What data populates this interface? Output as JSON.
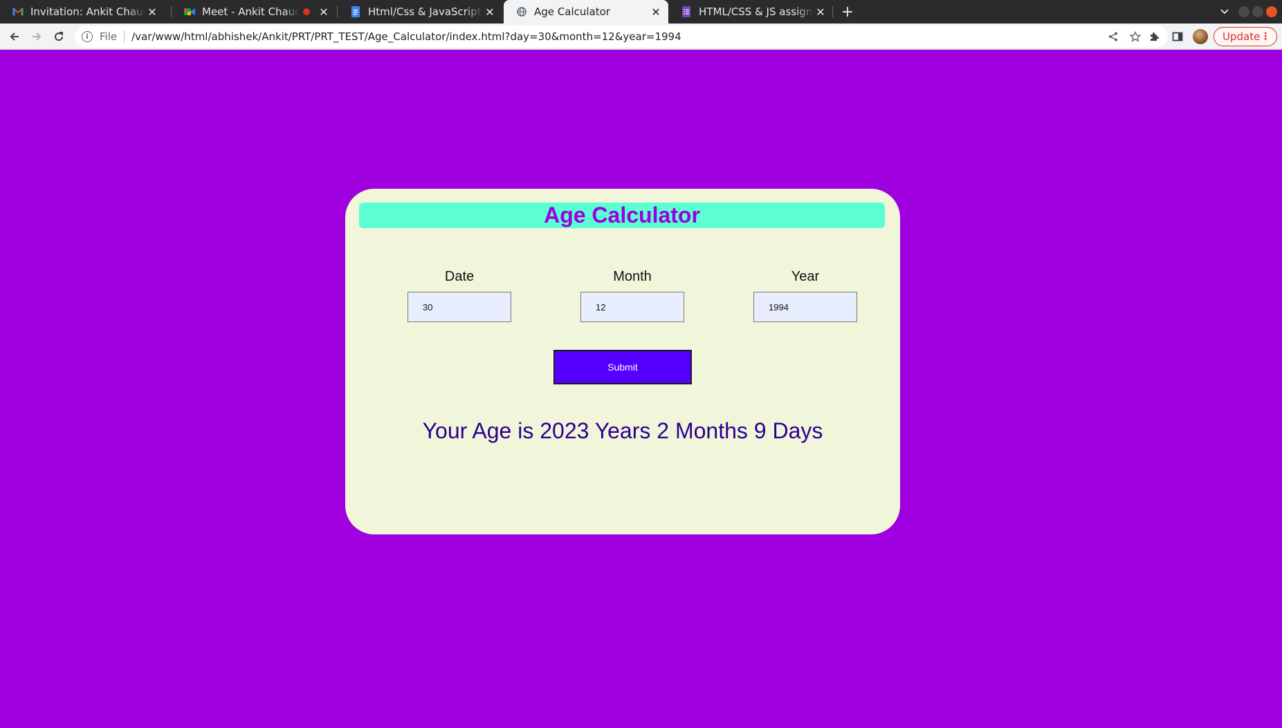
{
  "browser": {
    "tabs": [
      {
        "title": "Invitation: Ankit Chaudhary",
        "icon": "gmail-icon",
        "active": false
      },
      {
        "title": "Meet - Ankit Chaudhary",
        "icon": "meet-icon",
        "active": false,
        "recording": true
      },
      {
        "title": "Html/Css & JavaScript - Assignment",
        "icon": "docs-icon",
        "active": false
      },
      {
        "title": "Age Calculator",
        "icon": "globe-icon",
        "active": true
      },
      {
        "title": "HTML/CSS & JS assignment",
        "icon": "forms-icon",
        "active": false
      }
    ],
    "new_tab_label": "+",
    "address": {
      "scheme_label": "File",
      "url": "/var/www/html/abhishek/Ankit/PRT/PRT_TEST/Age_Calculator/index.html?day=30&month=12&year=1994"
    },
    "update_label": "Update"
  },
  "app": {
    "title": "Age Calculator",
    "fields": [
      {
        "label": "Date",
        "value": "30"
      },
      {
        "label": "Month",
        "value": "12"
      },
      {
        "label": "Year",
        "value": "1994"
      }
    ],
    "submit_label": "Submit",
    "result": "Your Age is 2023 Years 2 Months 9 Days"
  },
  "colors": {
    "page_background": "#a000e0",
    "card_background": "#f1f6da",
    "heading_background": "#5cffd3",
    "heading_text": "#9a00e0",
    "submit_background": "#5500ff",
    "result_text": "#2a0090",
    "input_background": "#e8eefe"
  }
}
